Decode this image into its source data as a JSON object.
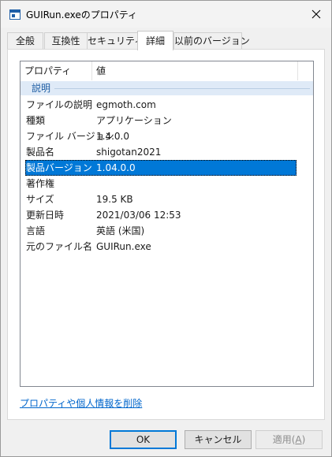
{
  "window": {
    "title": "GUIRun.exeのプロパティ"
  },
  "tabs": [
    {
      "label": "全般"
    },
    {
      "label": "互換性"
    },
    {
      "label": "セキュリティ"
    },
    {
      "label": "詳細",
      "active": true
    },
    {
      "label": "以前のバージョン"
    }
  ],
  "details": {
    "columns": {
      "property": "プロパティ",
      "value": "値"
    },
    "group": "説明",
    "rows": [
      {
        "key": "ファイルの説明",
        "value": "egmoth.com"
      },
      {
        "key": "種類",
        "value": "アプリケーション"
      },
      {
        "key": "ファイル バージョン",
        "value": "1.4.0.0"
      },
      {
        "key": "製品名",
        "value": "shigotan2021"
      },
      {
        "key": "製品バージョン",
        "value": "1.04.0.0",
        "selected": true
      },
      {
        "key": "著作権",
        "value": ""
      },
      {
        "key": "サイズ",
        "value": "19.5 KB"
      },
      {
        "key": "更新日時",
        "value": "2021/03/06 12:53"
      },
      {
        "key": "言語",
        "value": "英語 (米国)"
      },
      {
        "key": "元のファイル名",
        "value": "GUIRun.exe"
      }
    ]
  },
  "link": {
    "remove_label": "プロパティや個人情報を削除"
  },
  "buttons": {
    "ok": "OK",
    "cancel": "キャンセル",
    "apply_prefix": "適用(",
    "apply_key": "A",
    "apply_suffix": ")"
  },
  "colors": {
    "selection": "#0078d7",
    "group_bg": "#dfeaf7",
    "link": "#0066cc"
  }
}
